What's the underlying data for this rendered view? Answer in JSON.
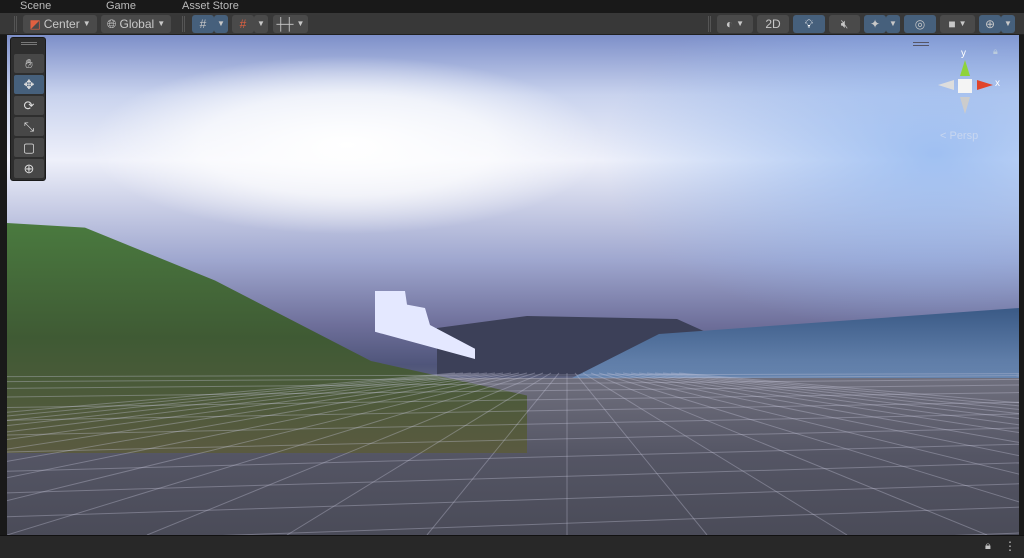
{
  "tabs": [
    "Scene",
    "Game",
    "Asset Store"
  ],
  "toolbar": {
    "pivot_label": "Center",
    "space_label": "Global",
    "mode_2d": "2D"
  },
  "tools": [
    "hand-tool",
    "move-tool",
    "rotate-tool",
    "scale-tool",
    "rect-tool",
    "transform-tool"
  ],
  "gizmo": {
    "y": "y",
    "x": "x",
    "projection": "< Persp"
  },
  "colors": {
    "active": "#46607c",
    "toolbar": "#383838",
    "x_axis": "#e0442c",
    "y_axis": "#8fd33b"
  }
}
